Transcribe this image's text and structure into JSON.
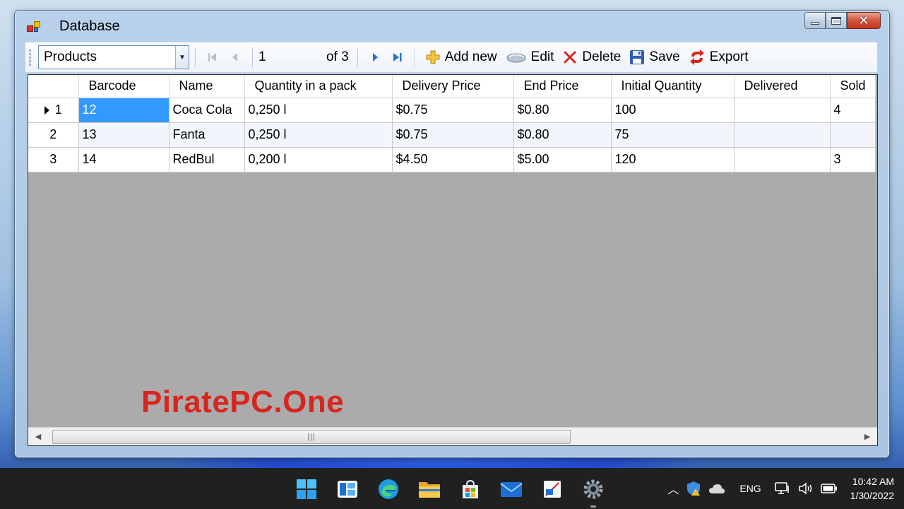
{
  "window": {
    "title": "Database"
  },
  "toolbar": {
    "table_select": "Products",
    "position": "1",
    "of_label": "of 3",
    "add_new_label": "Add new",
    "edit_label": "Edit",
    "delete_label": "Delete",
    "save_label": "Save",
    "export_label": "Export"
  },
  "grid": {
    "columns": [
      "Barcode",
      "Name",
      "Quantity in a pack",
      "Delivery Price",
      "End Price",
      "Initial Quantity",
      "Delivered",
      "Sold"
    ],
    "rows": [
      {
        "num": "1",
        "cells": [
          "12",
          "Coca Cola",
          "0,250 l",
          "$0.75",
          "$0.80",
          "100",
          "",
          "4"
        ]
      },
      {
        "num": "2",
        "cells": [
          "13",
          "Fanta",
          "0,250 l",
          "$0.75",
          "$0.80",
          "75",
          "",
          ""
        ]
      },
      {
        "num": "3",
        "cells": [
          "14",
          "RedBul",
          "0,200 l",
          "$4.50",
          "$5.00",
          "120",
          "",
          "3"
        ]
      }
    ]
  },
  "watermark": "PiratePC.One",
  "taskbar": {
    "language": "ENG",
    "time": "10:42 AM",
    "date": "1/30/2022"
  },
  "colors": {
    "selection": "#3399ff",
    "grid_background": "#ababab",
    "watermark": "#d7261f",
    "taskbar": "#202020"
  }
}
